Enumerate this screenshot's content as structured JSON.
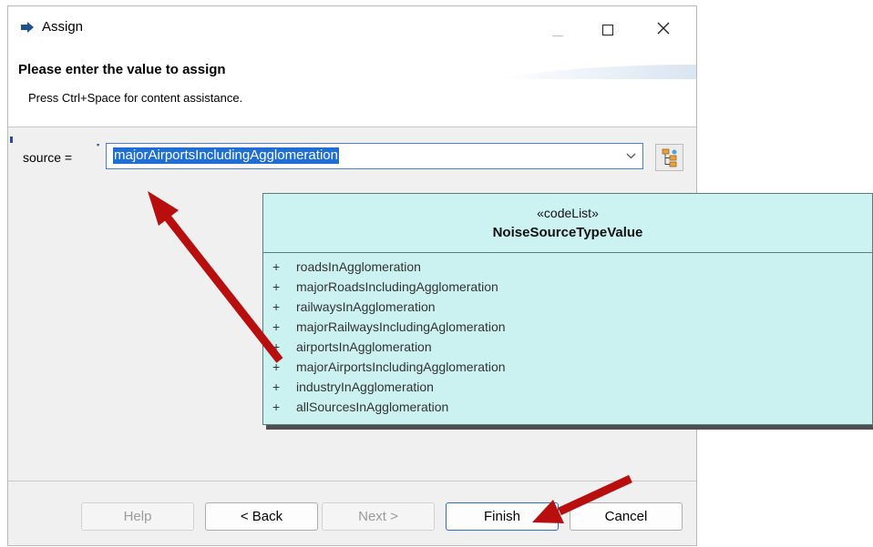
{
  "window": {
    "title": "Assign"
  },
  "header": {
    "title": "Please enter the value to assign",
    "description": "Press Ctrl+Space for content assistance."
  },
  "form": {
    "field_label": "source  =",
    "value": "majorAirportsIncludingAgglomeration"
  },
  "buttons": {
    "help": "Help",
    "back": "< Back",
    "next": "Next >",
    "finish": "Finish",
    "cancel": "Cancel"
  },
  "uml_class": {
    "stereotype": "«codeList»",
    "name": "NoiseSourceTypeValue",
    "values": [
      "roadsInAgglomeration",
      "majorRoadsIncludingAgglomeration",
      "railwaysInAgglomeration",
      "majorRailwaysIncludingAglomeration",
      "airportsInAgglomeration",
      "majorAirportsIncludingAgglomeration",
      "industryInAgglomeration",
      "allSourcesInAgglomeration"
    ],
    "visibility_marker": "+"
  },
  "colors": {
    "annotation_arrow": "#b80e0e",
    "selection": "#1e6ed6",
    "uml_fill": "#ccf1f1"
  }
}
